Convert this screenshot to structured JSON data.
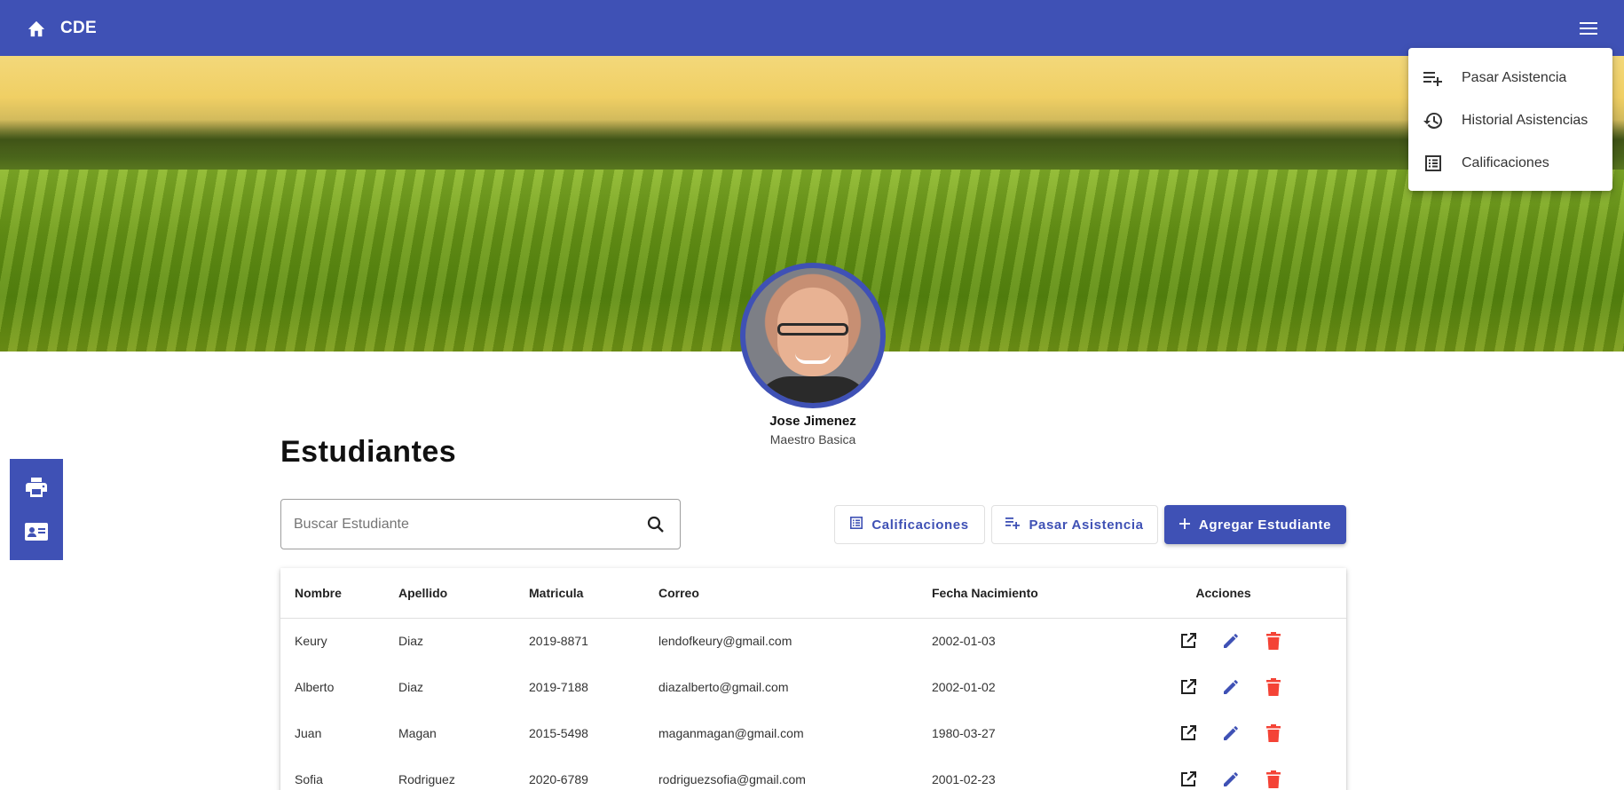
{
  "toolbar": {
    "title": "CDE",
    "home_icon": "home-icon",
    "menu_icon": "menu-icon",
    "color": "#3f51b5"
  },
  "menu": {
    "items": [
      {
        "label": "Pasar Asistencia",
        "icon": "playlist-add-icon"
      },
      {
        "label": "Historial Asistencias",
        "icon": "history-icon"
      },
      {
        "label": "Calificaciones",
        "icon": "list-alt-icon"
      }
    ]
  },
  "profile": {
    "name": "Jose Jimenez",
    "role": "Maestro Basica"
  },
  "side_bar": {
    "items": [
      "print-icon",
      "contact-card-icon"
    ]
  },
  "page": {
    "title": "Estudiantes"
  },
  "search": {
    "placeholder": "Buscar Estudiante",
    "value": ""
  },
  "buttons": {
    "calificaciones": "Calificaciones",
    "pasar_asistencia": "Pasar Asistencia",
    "agregar_estudiante": "Agregar Estudiante"
  },
  "table": {
    "headers": [
      "Nombre",
      "Apellido",
      "Matricula",
      "Correo",
      "Fecha Nacimiento",
      "Acciones"
    ],
    "rows": [
      {
        "nombre": "Keury",
        "apellido": "Diaz",
        "matricula": "2019-8871",
        "correo": "lendofkeury@gmail.com",
        "fecha": "2002-01-03"
      },
      {
        "nombre": "Alberto",
        "apellido": "Diaz",
        "matricula": "2019-7188",
        "correo": "diazalberto@gmail.com",
        "fecha": "2002-01-02"
      },
      {
        "nombre": "Juan",
        "apellido": "Magan",
        "matricula": "2015-5498",
        "correo": "maganmagan@gmail.com",
        "fecha": "1980-03-27"
      },
      {
        "nombre": "Sofia",
        "apellido": "Rodriguez",
        "matricula": "2020-6789",
        "correo": "rodriguezsofia@gmail.com",
        "fecha": "2001-02-23"
      }
    ],
    "action_colors": {
      "open": "#212121",
      "edit": "#3f51b5",
      "delete": "#f44336"
    }
  }
}
